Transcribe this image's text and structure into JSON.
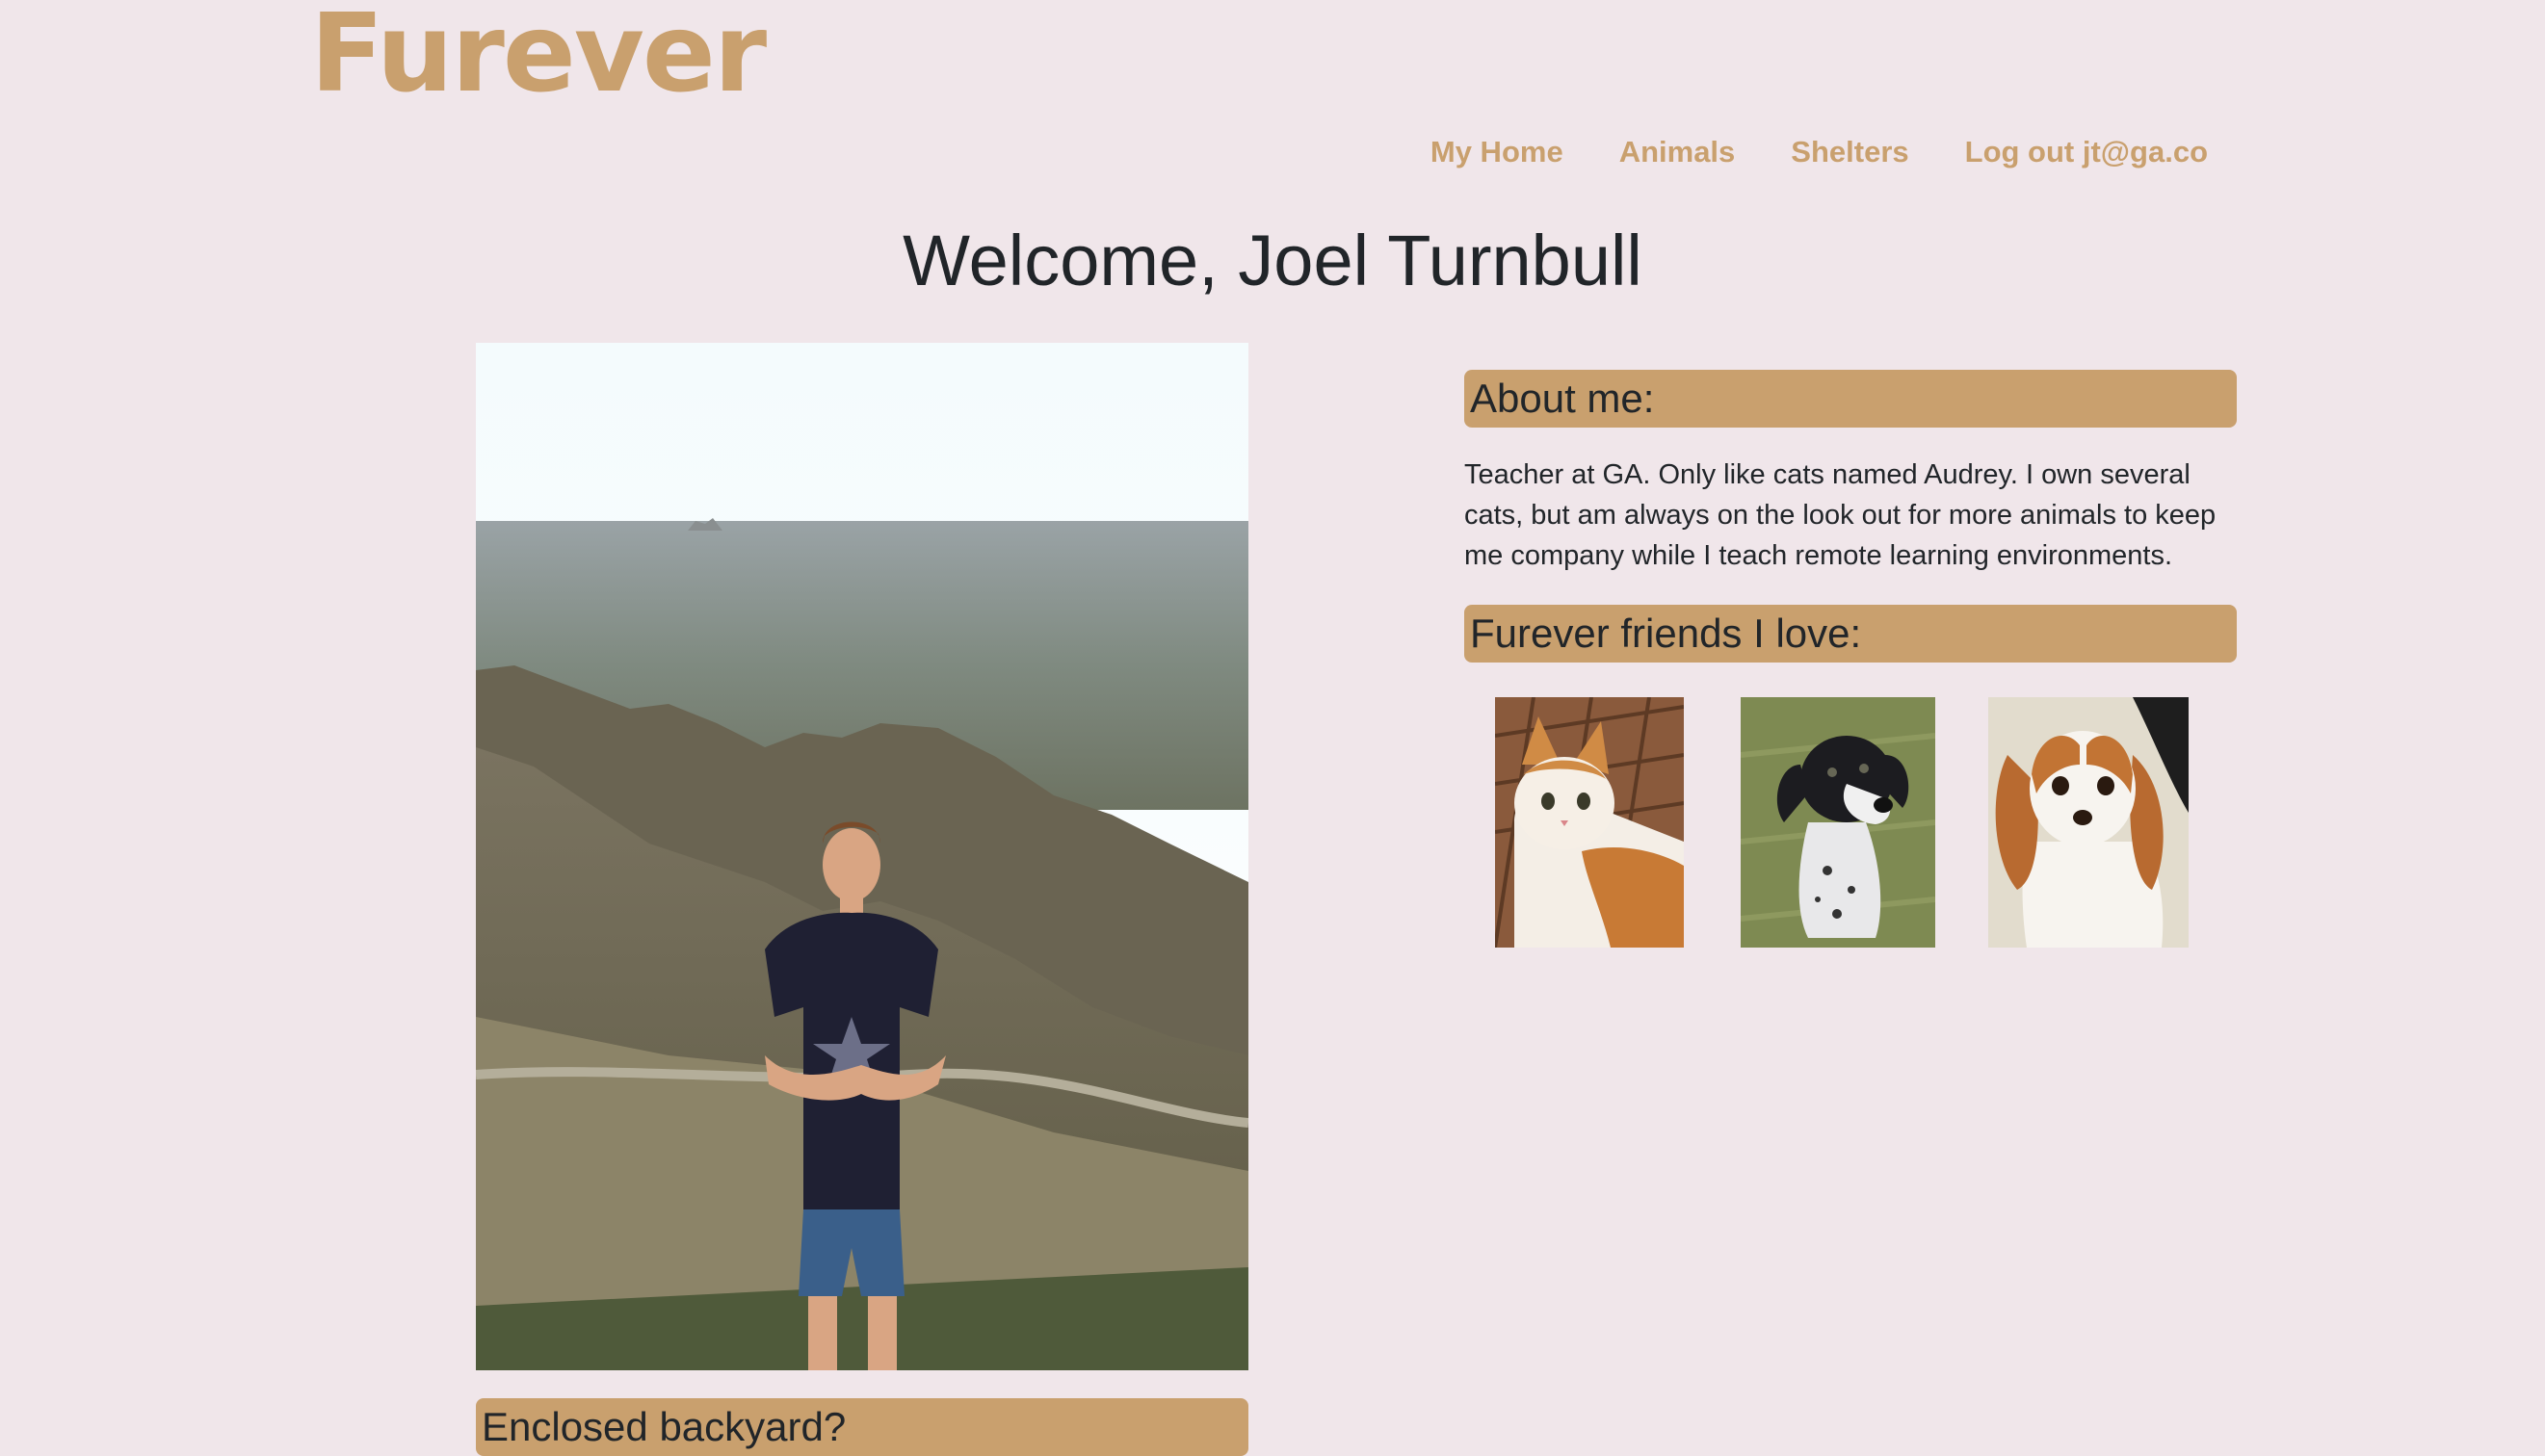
{
  "brand": {
    "name": "Furever"
  },
  "nav": {
    "items": [
      {
        "label": "My Home"
      },
      {
        "label": "Animals"
      },
      {
        "label": "Shelters"
      },
      {
        "label": "Log out jt@ga.co"
      }
    ]
  },
  "page": {
    "title": "Welcome, Joel Turnbull"
  },
  "profile": {
    "about_heading": "About me:",
    "about_text": "Teacher at GA. Only like cats named Audrey. I own several cats, but am always on the look out for more animals to keep me company while I teach remote learning environments.",
    "favorites_heading": "Furever friends I love:",
    "backyard_heading": "Enclosed backyard?"
  },
  "favorites": [
    {
      "animal": "orange and white kitten"
    },
    {
      "animal": "black and white dog"
    },
    {
      "animal": "cavalier king charles spaniel"
    }
  ],
  "colors": {
    "background": "#f0e6ea",
    "accent": "#c9a06e",
    "text": "#212529"
  }
}
